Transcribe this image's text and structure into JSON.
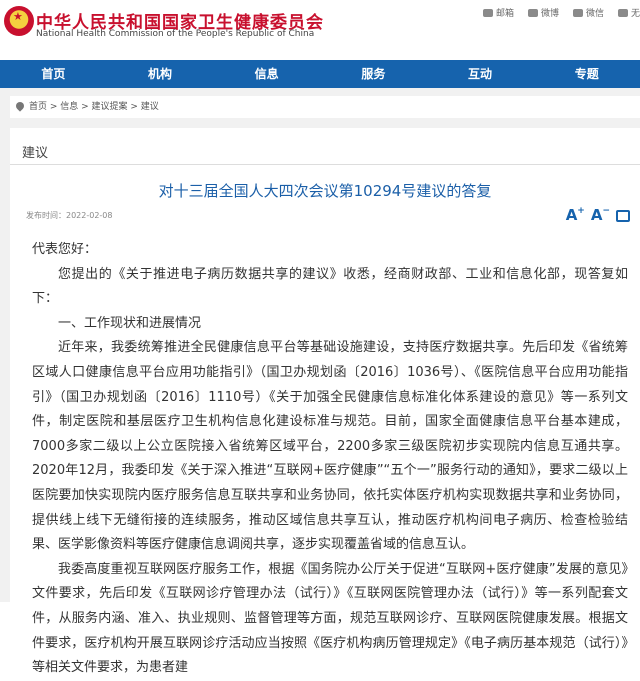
{
  "header": {
    "title_cn": "中华人民共和国国家卫生健康委员会",
    "title_en": "National Health Commission of the People's Republic of China",
    "tools": [
      "邮箱",
      "微博",
      "微信",
      "无"
    ]
  },
  "nav": [
    "首页",
    "机构",
    "信息",
    "服务",
    "互动",
    "专题"
  ],
  "breadcrumb": "首页 > 信息 > 建议提案 > 建议",
  "panel_tab": "建议",
  "doc": {
    "title": "对十三届全国人大四次会议第10294号建议的答复",
    "pubdate": "发布时间：2022-02-08",
    "paragraphs": [
      "代表您好：",
      "您提出的《关于推进电子病历数据共享的建议》收悉，经商财政部、工业和信息化部，现答复如下：",
      "一、工作现状和进展情况",
      "近年来，我委统筹推进全民健康信息平台等基础设施建设，支持医疗数据共享。先后印发《省统筹区域人口健康信息平台应用功能指引》（国卫办规划函〔2016〕1036号）、《医院信息平台应用功能指引》（国卫办规划函〔2016〕1110号）《关于加强全民健康信息标准化体系建设的意见》等一系列文件，制定医院和基层医疗卫生机构信息化建设标准与规范。目前，国家全面健康信息平台基本建成，7000多家二级以上公立医院接入省统筹区域平台，2200多家三级医院初步实现院内信息互通共享。2020年12月，我委印发《关于深入推进“互联网+医疗健康”“五个一”服务行动的通知》，要求二级以上医院要加快实现院内医疗服务信息互联共享和业务协同，依托实体医疗机构实现数据共享和业务协同，提供线上线下无缝衔接的连续服务，推动区域信息共享互认，推动医疗机构间电子病历、检查检验结果、医学影像资料等医疗健康信息调阅共享，逐步实现覆盖省域的信息互认。",
      "我委高度重视互联网医疗服务工作，根据《国务院办公厅关于促进“互联网+医疗健康”发展的意见》文件要求，先后印发《互联网诊疗管理办法（试行）》《互联网医院管理办法（试行）》等一系列配套文件，从服务内涵、准入、执业规则、监督管理等方面，规范互联网诊疗、互联网医院健康发展。根据文件要求，医疗机构开展互联网诊疗活动应当按照《医疗机构病历管理规定》《电子病历基本规范（试行）》等相关文件要求，为患者建"
    ]
  },
  "colors": {
    "brand_red": "#c8102e",
    "nav_blue": "#1663ad",
    "title_blue": "#1b5fa8"
  }
}
